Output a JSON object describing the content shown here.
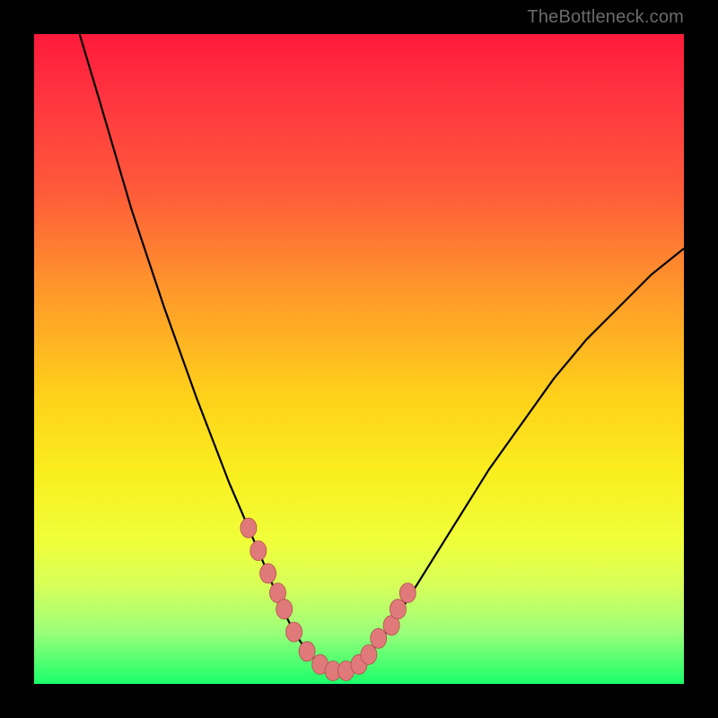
{
  "watermark": "TheBottleneck.com",
  "colors": {
    "frame": "#000000",
    "gradient_top": "#ff1a3a",
    "gradient_mid": "#ffd21a",
    "gradient_bottom": "#1aff6a",
    "curve": "#000000",
    "dot_fill": "#e07a7a",
    "dot_stroke": "#b34d4d"
  },
  "chart_data": {
    "type": "line",
    "title": "",
    "xlabel": "",
    "ylabel": "",
    "xlim": [
      0,
      100
    ],
    "ylim": [
      0,
      100
    ],
    "grid": false,
    "legend": false,
    "description": "V-shaped bottleneck curve with minimum near x≈45; y-axis inverted visually (low values at bottom colored green = good, high values at top colored red = bad)",
    "series": [
      {
        "name": "bottleneck-curve",
        "x": [
          7,
          10,
          15,
          20,
          25,
          30,
          33,
          36,
          38,
          40,
          42,
          44,
          46,
          48,
          50,
          52,
          55,
          60,
          65,
          70,
          75,
          80,
          85,
          90,
          95,
          100
        ],
        "y": [
          100,
          90,
          73,
          58,
          44,
          31,
          24,
          17,
          12,
          8,
          5,
          3,
          2,
          2,
          3,
          5,
          9,
          17,
          25,
          33,
          40,
          47,
          53,
          58,
          63,
          67
        ]
      }
    ],
    "markers": {
      "name": "highlighted-points",
      "x": [
        33.0,
        34.5,
        36.0,
        37.5,
        38.5,
        40.0,
        42.0,
        44.0,
        46.0,
        48.0,
        50.0,
        51.5,
        53.0,
        55.0,
        56.0,
        57.5
      ],
      "y": [
        24.0,
        20.5,
        17.0,
        14.0,
        11.5,
        8.0,
        5.0,
        3.0,
        2.0,
        2.0,
        3.0,
        4.5,
        7.0,
        9.0,
        11.5,
        14.0
      ]
    }
  }
}
